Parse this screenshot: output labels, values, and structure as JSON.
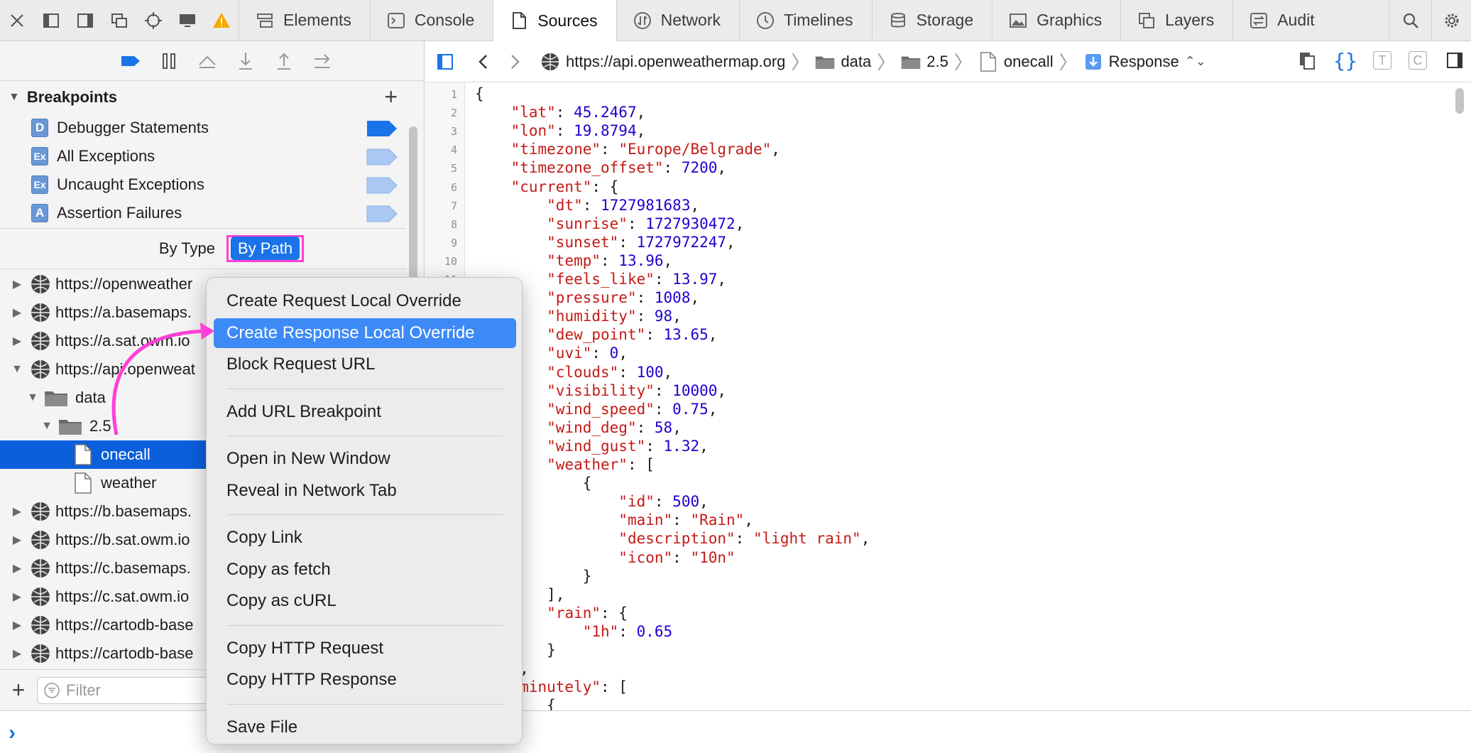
{
  "tabbar": {
    "tabs": [
      {
        "label": "Elements",
        "icon": "elements-icon"
      },
      {
        "label": "Console",
        "icon": "console-icon"
      },
      {
        "label": "Sources",
        "icon": "sources-icon",
        "active": true
      },
      {
        "label": "Network",
        "icon": "network-icon"
      },
      {
        "label": "Timelines",
        "icon": "timelines-icon"
      },
      {
        "label": "Storage",
        "icon": "storage-icon"
      },
      {
        "label": "Graphics",
        "icon": "graphics-icon"
      },
      {
        "label": "Layers",
        "icon": "layers-icon"
      },
      {
        "label": "Audit",
        "icon": "audit-icon"
      }
    ]
  },
  "breakpoints": {
    "title": "Breakpoints",
    "items": [
      {
        "badge": "D",
        "label": "Debugger Statements",
        "enabled": true
      },
      {
        "badge": "Ex",
        "label": "All Exceptions",
        "enabled": false
      },
      {
        "badge": "Ex",
        "label": "Uncaught Exceptions",
        "enabled": false
      },
      {
        "badge": "A",
        "label": "Assertion Failures",
        "enabled": false
      }
    ]
  },
  "scope": {
    "by_type": "By Type",
    "by_path": "By Path"
  },
  "tree": [
    {
      "label": "https://openweather",
      "kind": "origin",
      "expanded": false
    },
    {
      "label": "https://a.basemaps.",
      "kind": "origin",
      "expanded": false
    },
    {
      "label": "https://a.sat.owm.io",
      "kind": "origin",
      "expanded": false
    },
    {
      "label": "https://api.openweat",
      "kind": "origin",
      "expanded": true
    },
    {
      "label": "data",
      "kind": "folder",
      "expanded": true
    },
    {
      "label": "2.5",
      "kind": "folder",
      "expanded": true
    },
    {
      "label": "onecall",
      "kind": "file",
      "selected": true
    },
    {
      "label": "weather",
      "kind": "file"
    },
    {
      "label": "https://b.basemaps.",
      "kind": "origin",
      "expanded": false
    },
    {
      "label": "https://b.sat.owm.io",
      "kind": "origin",
      "expanded": false
    },
    {
      "label": "https://c.basemaps.",
      "kind": "origin",
      "expanded": false
    },
    {
      "label": "https://c.sat.owm.io",
      "kind": "origin",
      "expanded": false
    },
    {
      "label": "https://cartodb-base",
      "kind": "origin",
      "expanded": false
    },
    {
      "label": "https://cartodb-base",
      "kind": "origin",
      "expanded": false
    }
  ],
  "filter": {
    "placeholder": "Filter"
  },
  "navbar": {
    "origin": "https://api.openweathermap.org",
    "path": [
      "data",
      "2.5",
      "onecall"
    ],
    "resource": "Response"
  },
  "code_lines": [
    {
      "n": "1",
      "t": [
        [
          "p",
          "{"
        ]
      ]
    },
    {
      "n": "2",
      "t": [
        [
          "p",
          "    "
        ],
        [
          "k",
          "\"lat\""
        ],
        [
          "p",
          ": "
        ],
        [
          "n",
          "45.2467"
        ],
        [
          "p",
          ","
        ]
      ]
    },
    {
      "n": "3",
      "t": [
        [
          "p",
          "    "
        ],
        [
          "k",
          "\"lon\""
        ],
        [
          "p",
          ": "
        ],
        [
          "n",
          "19.8794"
        ],
        [
          "p",
          ","
        ]
      ]
    },
    {
      "n": "4",
      "t": [
        [
          "p",
          "    "
        ],
        [
          "k",
          "\"timezone\""
        ],
        [
          "p",
          ": "
        ],
        [
          "s",
          "\"Europe/Belgrade\""
        ],
        [
          "p",
          ","
        ]
      ]
    },
    {
      "n": "5",
      "t": [
        [
          "p",
          "    "
        ],
        [
          "k",
          "\"timezone_offset\""
        ],
        [
          "p",
          ": "
        ],
        [
          "n",
          "7200"
        ],
        [
          "p",
          ","
        ]
      ]
    },
    {
      "n": "6",
      "t": [
        [
          "p",
          "    "
        ],
        [
          "k",
          "\"current\""
        ],
        [
          "p",
          ": {"
        ]
      ]
    },
    {
      "n": "7",
      "t": [
        [
          "p",
          "        "
        ],
        [
          "k",
          "\"dt\""
        ],
        [
          "p",
          ": "
        ],
        [
          "n",
          "1727981683"
        ],
        [
          "p",
          ","
        ]
      ]
    },
    {
      "n": "8",
      "t": [
        [
          "p",
          "        "
        ],
        [
          "k",
          "\"sunrise\""
        ],
        [
          "p",
          ": "
        ],
        [
          "n",
          "1727930472"
        ],
        [
          "p",
          ","
        ]
      ]
    },
    {
      "n": "9",
      "t": [
        [
          "p",
          "        "
        ],
        [
          "k",
          "\"sunset\""
        ],
        [
          "p",
          ": "
        ],
        [
          "n",
          "1727972247"
        ],
        [
          "p",
          ","
        ]
      ]
    },
    {
      "n": "10",
      "t": [
        [
          "p",
          "        "
        ],
        [
          "k",
          "\"temp\""
        ],
        [
          "p",
          ": "
        ],
        [
          "n",
          "13.96"
        ],
        [
          "p",
          ","
        ]
      ]
    },
    {
      "n": "11",
      "t": [
        [
          "p",
          "        "
        ],
        [
          "k",
          "\"feels_like\""
        ],
        [
          "p",
          ": "
        ],
        [
          "n",
          "13.97"
        ],
        [
          "p",
          ","
        ]
      ]
    },
    {
      "n": "",
      "t": [
        [
          "p",
          "        "
        ],
        [
          "k",
          "\"pressure\""
        ],
        [
          "p",
          ": "
        ],
        [
          "n",
          "1008"
        ],
        [
          "p",
          ","
        ]
      ]
    },
    {
      "n": "",
      "t": [
        [
          "p",
          "        "
        ],
        [
          "k",
          "\"humidity\""
        ],
        [
          "p",
          ": "
        ],
        [
          "n",
          "98"
        ],
        [
          "p",
          ","
        ]
      ]
    },
    {
      "n": "",
      "t": [
        [
          "p",
          "        "
        ],
        [
          "k",
          "\"dew_point\""
        ],
        [
          "p",
          ": "
        ],
        [
          "n",
          "13.65"
        ],
        [
          "p",
          ","
        ]
      ]
    },
    {
      "n": "",
      "t": [
        [
          "p",
          "        "
        ],
        [
          "k",
          "\"uvi\""
        ],
        [
          "p",
          ": "
        ],
        [
          "n",
          "0"
        ],
        [
          "p",
          ","
        ]
      ]
    },
    {
      "n": "",
      "t": [
        [
          "p",
          "        "
        ],
        [
          "k",
          "\"clouds\""
        ],
        [
          "p",
          ": "
        ],
        [
          "n",
          "100"
        ],
        [
          "p",
          ","
        ]
      ]
    },
    {
      "n": "",
      "t": [
        [
          "p",
          "        "
        ],
        [
          "k",
          "\"visibility\""
        ],
        [
          "p",
          ": "
        ],
        [
          "n",
          "10000"
        ],
        [
          "p",
          ","
        ]
      ]
    },
    {
      "n": "",
      "t": [
        [
          "p",
          "        "
        ],
        [
          "k",
          "\"wind_speed\""
        ],
        [
          "p",
          ": "
        ],
        [
          "n",
          "0.75"
        ],
        [
          "p",
          ","
        ]
      ]
    },
    {
      "n": "",
      "t": [
        [
          "p",
          "        "
        ],
        [
          "k",
          "\"wind_deg\""
        ],
        [
          "p",
          ": "
        ],
        [
          "n",
          "58"
        ],
        [
          "p",
          ","
        ]
      ]
    },
    {
      "n": "",
      "t": [
        [
          "p",
          "        "
        ],
        [
          "k",
          "\"wind_gust\""
        ],
        [
          "p",
          ": "
        ],
        [
          "n",
          "1.32"
        ],
        [
          "p",
          ","
        ]
      ]
    },
    {
      "n": "",
      "t": [
        [
          "p",
          "        "
        ],
        [
          "k",
          "\"weather\""
        ],
        [
          "p",
          ": ["
        ]
      ]
    },
    {
      "n": "",
      "t": [
        [
          "p",
          "            {"
        ]
      ]
    },
    {
      "n": "",
      "t": [
        [
          "p",
          "                "
        ],
        [
          "k",
          "\"id\""
        ],
        [
          "p",
          ": "
        ],
        [
          "n",
          "500"
        ],
        [
          "p",
          ","
        ]
      ]
    },
    {
      "n": "",
      "t": [
        [
          "p",
          "                "
        ],
        [
          "k",
          "\"main\""
        ],
        [
          "p",
          ": "
        ],
        [
          "s",
          "\"Rain\""
        ],
        [
          "p",
          ","
        ]
      ]
    },
    {
      "n": "",
      "t": [
        [
          "p",
          "                "
        ],
        [
          "k",
          "\"description\""
        ],
        [
          "p",
          ": "
        ],
        [
          "s",
          "\"light rain\""
        ],
        [
          "p",
          ","
        ]
      ]
    },
    {
      "n": "",
      "t": [
        [
          "p",
          "                "
        ],
        [
          "k",
          "\"icon\""
        ],
        [
          "p",
          ": "
        ],
        [
          "s",
          "\"10n\""
        ]
      ]
    },
    {
      "n": "",
      "t": [
        [
          "p",
          "            }"
        ]
      ]
    },
    {
      "n": "",
      "t": [
        [
          "p",
          "        ],"
        ]
      ]
    },
    {
      "n": "",
      "t": [
        [
          "p",
          "        "
        ],
        [
          "k",
          "\"rain\""
        ],
        [
          "p",
          ": {"
        ]
      ]
    },
    {
      "n": "",
      "t": [
        [
          "p",
          "            "
        ],
        [
          "k",
          "\"1h\""
        ],
        [
          "p",
          ": "
        ],
        [
          "n",
          "0.65"
        ]
      ]
    },
    {
      "n": "",
      "t": [
        [
          "p",
          "        }"
        ]
      ]
    },
    {
      "n": "",
      "t": [
        [
          "p",
          "    },"
        ]
      ]
    },
    {
      "n": "",
      "t": [
        [
          "p",
          "    "
        ],
        [
          "k",
          "\"minutely\""
        ],
        [
          "p",
          ": ["
        ]
      ]
    },
    {
      "n": "",
      "t": [
        [
          "p",
          "        {"
        ]
      ]
    }
  ],
  "context_menu": {
    "groups": [
      [
        "Create Request Local Override",
        "Create Response Local Override",
        "Block Request URL"
      ],
      [
        "Add URL Breakpoint"
      ],
      [
        "Open in New Window",
        "Reveal in Network Tab"
      ],
      [
        "Copy Link",
        "Copy as fetch",
        "Copy as cURL"
      ],
      [
        "Copy HTTP Request",
        "Copy HTTP Response"
      ],
      [
        "Save File"
      ]
    ],
    "highlighted": "Create Response Local Override"
  },
  "colors": {
    "accent": "#0a5fdb",
    "menu_highlight": "#3d8af7",
    "annotation": "#ff3fd6",
    "json_key": "#c41a16",
    "json_number": "#1c00cf"
  }
}
